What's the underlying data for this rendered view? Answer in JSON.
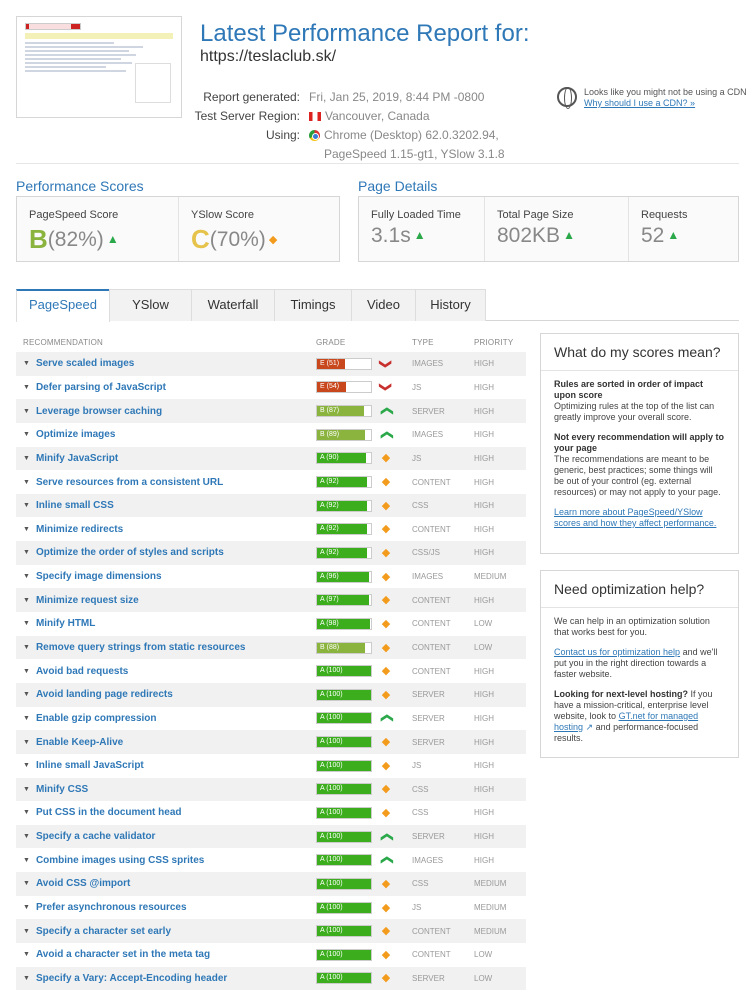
{
  "header": {
    "title": "Latest Performance Report for:",
    "url": "https://teslaclub.sk/",
    "report_generated_label": "Report generated:",
    "report_generated_value": "Fri, Jan 25, 2019, 8:44 PM -0800",
    "region_label": "Test Server Region:",
    "region_value": "Vancouver, Canada",
    "using_label": "Using:",
    "using_value_1": "Chrome (Desktop) 62.0.3202.94,",
    "using_value_2": "PageSpeed 1.15-gt1, YSlow 3.1.8",
    "cdn_text": "Looks like you might not be using a CDN",
    "cdn_link": "Why should I use a CDN? »"
  },
  "scores": {
    "section_title": "Performance Scores",
    "pagespeed_label": "PageSpeed Score",
    "pagespeed_grade": "B",
    "pagespeed_value": "(82%)",
    "yslow_label": "YSlow Score",
    "yslow_grade": "C",
    "yslow_value": "(70%)"
  },
  "details": {
    "section_title": "Page Details",
    "load_label": "Fully Loaded Time",
    "load_value": "3.1s",
    "size_label": "Total Page Size",
    "size_value": "802KB",
    "requests_label": "Requests",
    "requests_value": "52"
  },
  "tabs": [
    "PageSpeed",
    "YSlow",
    "Waterfall",
    "Timings",
    "Video",
    "History"
  ],
  "table": {
    "headers": [
      "RECOMMENDATION",
      "GRADE",
      "TYPE",
      "PRIORITY"
    ],
    "rows": [
      {
        "name": "Serve scaled images",
        "grade": "E (51)",
        "score": 51,
        "type": "IMAGES",
        "priority": "HIGH",
        "indicator": "down"
      },
      {
        "name": "Defer parsing of JavaScript",
        "grade": "E (54)",
        "score": 54,
        "type": "JS",
        "priority": "HIGH",
        "indicator": "down"
      },
      {
        "name": "Leverage browser caching",
        "grade": "B (87)",
        "score": 87,
        "type": "SERVER",
        "priority": "HIGH",
        "indicator": "up"
      },
      {
        "name": "Optimize images",
        "grade": "B (89)",
        "score": 89,
        "type": "IMAGES",
        "priority": "HIGH",
        "indicator": "up"
      },
      {
        "name": "Minify JavaScript",
        "grade": "A (90)",
        "score": 90,
        "type": "JS",
        "priority": "HIGH",
        "indicator": "dia"
      },
      {
        "name": "Serve resources from a consistent URL",
        "grade": "A (92)",
        "score": 92,
        "type": "CONTENT",
        "priority": "HIGH",
        "indicator": "dia"
      },
      {
        "name": "Inline small CSS",
        "grade": "A (92)",
        "score": 92,
        "type": "CSS",
        "priority": "HIGH",
        "indicator": "dia"
      },
      {
        "name": "Minimize redirects",
        "grade": "A (92)",
        "score": 92,
        "type": "CONTENT",
        "priority": "HIGH",
        "indicator": "dia"
      },
      {
        "name": "Optimize the order of styles and scripts",
        "grade": "A (92)",
        "score": 92,
        "type": "CSS/JS",
        "priority": "HIGH",
        "indicator": "dia"
      },
      {
        "name": "Specify image dimensions",
        "grade": "A (96)",
        "score": 96,
        "type": "IMAGES",
        "priority": "MEDIUM",
        "indicator": "dia"
      },
      {
        "name": "Minimize request size",
        "grade": "A (97)",
        "score": 97,
        "type": "CONTENT",
        "priority": "HIGH",
        "indicator": "dia"
      },
      {
        "name": "Minify HTML",
        "grade": "A (98)",
        "score": 98,
        "type": "CONTENT",
        "priority": "LOW",
        "indicator": "dia"
      },
      {
        "name": "Remove query strings from static resources",
        "grade": "B (88)",
        "score": 88,
        "type": "CONTENT",
        "priority": "LOW",
        "indicator": "dia"
      },
      {
        "name": "Avoid bad requests",
        "grade": "A (100)",
        "score": 100,
        "type": "CONTENT",
        "priority": "HIGH",
        "indicator": "dia"
      },
      {
        "name": "Avoid landing page redirects",
        "grade": "A (100)",
        "score": 100,
        "type": "SERVER",
        "priority": "HIGH",
        "indicator": "dia"
      },
      {
        "name": "Enable gzip compression",
        "grade": "A (100)",
        "score": 100,
        "type": "SERVER",
        "priority": "HIGH",
        "indicator": "up"
      },
      {
        "name": "Enable Keep-Alive",
        "grade": "A (100)",
        "score": 100,
        "type": "SERVER",
        "priority": "HIGH",
        "indicator": "dia"
      },
      {
        "name": "Inline small JavaScript",
        "grade": "A (100)",
        "score": 100,
        "type": "JS",
        "priority": "HIGH",
        "indicator": "dia"
      },
      {
        "name": "Minify CSS",
        "grade": "A (100)",
        "score": 100,
        "type": "CSS",
        "priority": "HIGH",
        "indicator": "dia"
      },
      {
        "name": "Put CSS in the document head",
        "grade": "A (100)",
        "score": 100,
        "type": "CSS",
        "priority": "HIGH",
        "indicator": "dia"
      },
      {
        "name": "Specify a cache validator",
        "grade": "A (100)",
        "score": 100,
        "type": "SERVER",
        "priority": "HIGH",
        "indicator": "up"
      },
      {
        "name": "Combine images using CSS sprites",
        "grade": "A (100)",
        "score": 100,
        "type": "IMAGES",
        "priority": "HIGH",
        "indicator": "up"
      },
      {
        "name": "Avoid CSS @import",
        "grade": "A (100)",
        "score": 100,
        "type": "CSS",
        "priority": "MEDIUM",
        "indicator": "dia"
      },
      {
        "name": "Prefer asynchronous resources",
        "grade": "A (100)",
        "score": 100,
        "type": "JS",
        "priority": "MEDIUM",
        "indicator": "dia"
      },
      {
        "name": "Specify a character set early",
        "grade": "A (100)",
        "score": 100,
        "type": "CONTENT",
        "priority": "MEDIUM",
        "indicator": "dia"
      },
      {
        "name": "Avoid a character set in the meta tag",
        "grade": "A (100)",
        "score": 100,
        "type": "CONTENT",
        "priority": "LOW",
        "indicator": "dia"
      },
      {
        "name": "Specify a Vary: Accept-Encoding header",
        "grade": "A (100)",
        "score": 100,
        "type": "SERVER",
        "priority": "LOW",
        "indicator": "dia"
      }
    ]
  },
  "scores_help": {
    "title": "What do my scores mean?",
    "p1_bold": "Rules are sorted in order of impact upon score",
    "p1_text": "Optimizing rules at the top of the list can greatly improve your overall score.",
    "p2_bold": "Not every recommendation will apply to your page",
    "p2_text": "The recommendations are meant to be generic, best practices; some things will be out of your control (eg. external resources) or may not apply to your page.",
    "link": "Learn more about PageSpeed/YSlow scores and how they affect performance."
  },
  "optimization_help": {
    "title": "Need optimization help?",
    "p1": "We can help in an optimization solution that works best for you.",
    "contact_link": "Contact us for optimization help",
    "p2_text": "and we'll put you in the right direction towards a faster website.",
    "p3_bold": "Looking for next-level hosting?",
    "p3_text": "If you have a mission-critical, enterprise level website, look to",
    "gtnet_link": "GT.net for managed hosting",
    "p3_tail": "and performance-focused results."
  },
  "colors": {
    "accent": "#2f78b7",
    "grade_a": "#3cae1d",
    "grade_b": "#8ab43e",
    "grade_e": "#c8471c"
  }
}
